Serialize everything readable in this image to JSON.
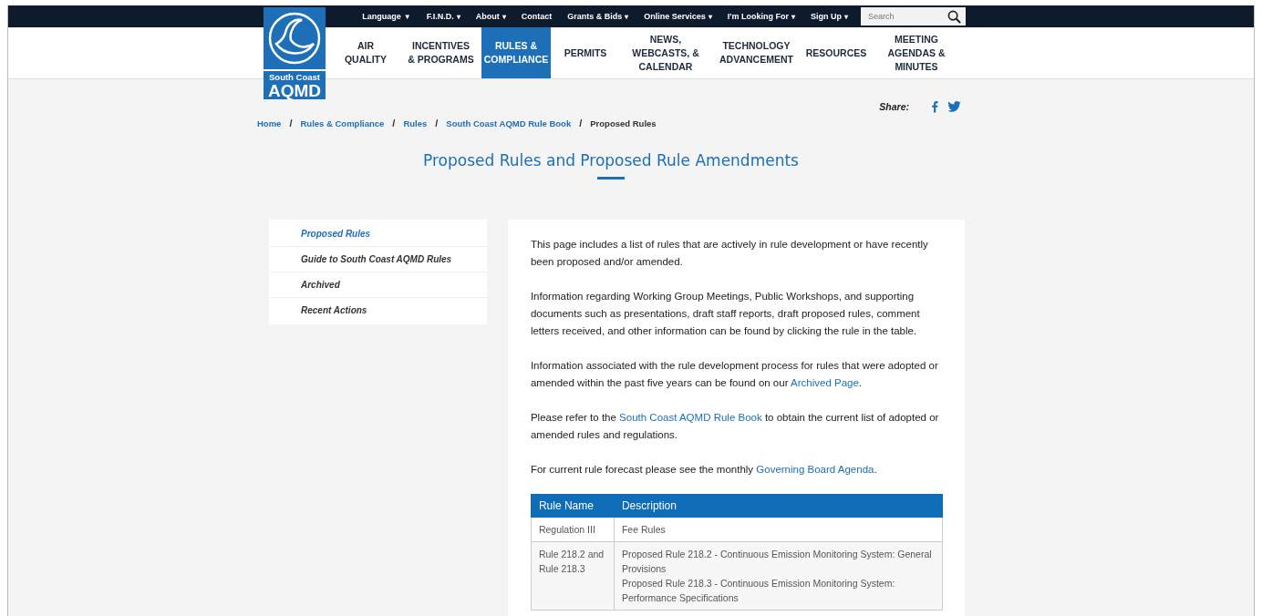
{
  "logo": {
    "line1": "South Coast",
    "line2": "AQMD"
  },
  "top_links": [
    {
      "label": "Language",
      "caret": "▼"
    },
    {
      "label": "F.I.N.D.",
      "caret": "▾"
    },
    {
      "label": "About",
      "caret": "▾"
    },
    {
      "label": "Contact"
    },
    {
      "label": "Grants & Bids",
      "caret": "▾"
    },
    {
      "label": "Online Services",
      "caret": "▾"
    },
    {
      "label": "I'm Looking For",
      "caret": "▾"
    },
    {
      "label": "Sign Up",
      "caret": "▾"
    }
  ],
  "search": {
    "placeholder": "Search"
  },
  "nav": [
    {
      "label": "AIR QUALITY",
      "selected": false
    },
    {
      "label": "INCENTIVES & PROGRAMS",
      "selected": false
    },
    {
      "label": "RULES & COMPLIANCE",
      "selected": true
    },
    {
      "label": "PERMITS",
      "selected": false
    },
    {
      "label": "NEWS, WEBCASTS, & CALENDAR",
      "selected": false
    },
    {
      "label": "TECHNOLOGY ADVANCEMENT",
      "selected": false
    },
    {
      "label": "RESOURCES",
      "selected": false
    },
    {
      "label": "MEETING AGENDAS & MINUTES",
      "selected": false
    }
  ],
  "share": {
    "label": "Share:"
  },
  "breadcrumb": [
    {
      "label": "Home",
      "current": false
    },
    {
      "separator": "/",
      "label": "Rules & Compliance",
      "current": false
    },
    {
      "separator": "/",
      "label": "Rules",
      "current": false
    },
    {
      "separator": "/",
      "label": "South Coast AQMD Rule Book",
      "current": false
    },
    {
      "separator": "/",
      "label": "Proposed Rules",
      "current": true
    }
  ],
  "title": "Proposed Rules and Proposed Rule Amendments",
  "sidebar": {
    "items": [
      {
        "label": "Proposed Rules",
        "selected": true
      },
      {
        "label": "Guide to South Coast AQMD Rules",
        "selected": false
      },
      {
        "label": "Archived",
        "selected": false
      },
      {
        "label": "Recent Actions",
        "selected": false
      }
    ]
  },
  "paragraphs": [
    {
      "segments": [
        {
          "text": "This page includes a list of rules that are actively in rule development or have recently been proposed and/or amended.",
          "link": false
        }
      ]
    },
    {
      "segments": [
        {
          "text": "Information regarding Working Group Meetings, Public Workshops, and supporting documents such as presentations, draft staff reports, draft proposed rules, comment letters received, and other information can be found by clicking the rule in the table.",
          "link": false
        }
      ]
    },
    {
      "segments": [
        {
          "text": "Information associated with the rule development process for rules that were adopted or amended within the past five years can be found on our ",
          "link": false
        },
        {
          "text": "Archived Page",
          "link": true
        },
        {
          "text": ".",
          "link": false
        }
      ]
    },
    {
      "segments": [
        {
          "text": "Please refer to the ",
          "link": false
        },
        {
          "text": "South Coast AQMD Rule Book",
          "link": true
        },
        {
          "text": " to obtain the current list of adopted or amended rules and regulations.",
          "link": false
        }
      ]
    },
    {
      "segments": [
        {
          "text": "For current rule forecast please see the monthly ",
          "link": false
        },
        {
          "text": "Governing Board Agenda",
          "link": true
        },
        {
          "text": ".",
          "link": false
        }
      ]
    }
  ],
  "table": {
    "columns": [
      "Rule Name",
      "Description"
    ],
    "rows": [
      {
        "rule_name": "Regulation III",
        "description": [
          "Fee Rules"
        ]
      },
      {
        "rule_name": "Rule 218.2 and Rule 218.3",
        "description": [
          "Proposed Rule 218.2 - Continuous Emission Monitoring System: General Provisions",
          "Proposed Rule 218.3 - Continuous Emission Monitoring System: Performance Specifications"
        ]
      }
    ]
  }
}
